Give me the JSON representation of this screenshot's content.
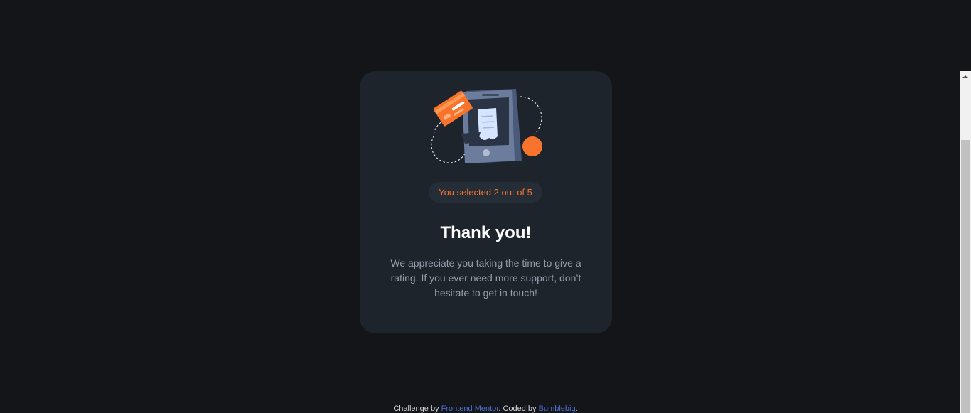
{
  "card": {
    "illustration_icon": "phone-receipt-payment-illustration",
    "selected_text": "You selected 2 out of 5",
    "rating_selected": 2,
    "rating_max": 5,
    "title": "Thank you!",
    "description": "We appreciate you taking the time to give a rating. If you ever need more support, don’t hesitate to get in touch!"
  },
  "footer": {
    "prefix": "Challenge by ",
    "challenge_link": "Frontend Mentor",
    "middle": ". Coded by ",
    "author_link": "Bumblebig",
    "suffix": "."
  },
  "colors": {
    "background": "#131518",
    "card": "#1e242c",
    "accent": "#f8732c",
    "muted_text": "#959eac",
    "link": "#4c6fd3"
  }
}
